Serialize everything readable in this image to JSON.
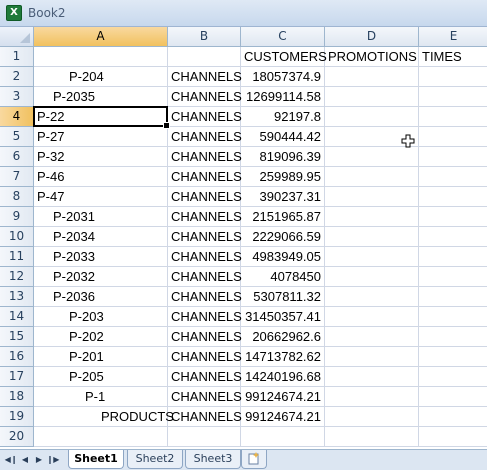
{
  "window": {
    "title": "Book2",
    "app_icon": "excel-icon"
  },
  "columns": [
    "A",
    "B",
    "C",
    "D",
    "E"
  ],
  "selected_cell": "A4",
  "rows": [
    {
      "n": "1",
      "a": "",
      "b": "",
      "c": "CUSTOMERS",
      "d": "PROMOTIONS",
      "e": "TIMES"
    },
    {
      "n": "2",
      "a": "P-204",
      "b": "CHANNELS",
      "c": "18057374.9",
      "d": "",
      "e": ""
    },
    {
      "n": "3",
      "a": "P-2035",
      "b": "CHANNELS",
      "c": "12699114.58",
      "d": "",
      "e": ""
    },
    {
      "n": "4",
      "a": "P-22",
      "b": "CHANNELS",
      "c": "92197.8",
      "d": "",
      "e": ""
    },
    {
      "n": "5",
      "a": "P-27",
      "b": "CHANNELS",
      "c": "590444.42",
      "d": "",
      "e": ""
    },
    {
      "n": "6",
      "a": "P-32",
      "b": "CHANNELS",
      "c": "819096.39",
      "d": "",
      "e": ""
    },
    {
      "n": "7",
      "a": "P-46",
      "b": "CHANNELS",
      "c": "259989.95",
      "d": "",
      "e": ""
    },
    {
      "n": "8",
      "a": "P-47",
      "b": "CHANNELS",
      "c": "390237.31",
      "d": "",
      "e": ""
    },
    {
      "n": "9",
      "a": "P-2031",
      "b": "CHANNELS",
      "c": "2151965.87",
      "d": "",
      "e": ""
    },
    {
      "n": "10",
      "a": "P-2034",
      "b": "CHANNELS",
      "c": "2229066.59",
      "d": "",
      "e": ""
    },
    {
      "n": "11",
      "a": "P-2033",
      "b": "CHANNELS",
      "c": "4983949.05",
      "d": "",
      "e": ""
    },
    {
      "n": "12",
      "a": "P-2032",
      "b": "CHANNELS",
      "c": "4078450",
      "d": "",
      "e": ""
    },
    {
      "n": "13",
      "a": "P-2036",
      "b": "CHANNELS",
      "c": "5307811.32",
      "d": "",
      "e": ""
    },
    {
      "n": "14",
      "a": "P-203",
      "b": "CHANNELS",
      "c": "31450357.41",
      "d": "",
      "e": ""
    },
    {
      "n": "15",
      "a": "P-202",
      "b": "CHANNELS",
      "c": "20662962.6",
      "d": "",
      "e": ""
    },
    {
      "n": "16",
      "a": "P-201",
      "b": "CHANNELS",
      "c": "14713782.62",
      "d": "",
      "e": ""
    },
    {
      "n": "17",
      "a": "P-205",
      "b": "CHANNELS",
      "c": "14240196.68",
      "d": "",
      "e": ""
    },
    {
      "n": "18",
      "a": "P-1",
      "b": "CHANNELS",
      "c": "99124674.21",
      "d": "",
      "e": ""
    },
    {
      "n": "19",
      "a": "PRODUCTS",
      "b": "CHANNELS",
      "c": "99124674.21",
      "d": "",
      "e": ""
    },
    {
      "n": "20",
      "a": "",
      "b": "",
      "c": "",
      "d": "",
      "e": ""
    }
  ],
  "a_indent": [
    0,
    4,
    2,
    0,
    0,
    0,
    0,
    0,
    2,
    2,
    2,
    2,
    2,
    4,
    4,
    4,
    4,
    6,
    8,
    0
  ],
  "sheet_tabs": [
    {
      "label": "Sheet1",
      "active": true
    },
    {
      "label": "Sheet2",
      "active": false
    },
    {
      "label": "Sheet3",
      "active": false
    }
  ],
  "nav_icons": [
    "first-sheet-icon",
    "prev-sheet-icon",
    "next-sheet-icon",
    "last-sheet-icon"
  ],
  "colors": {
    "header_active": "#f1c15f",
    "gridline": "#d0d7e5",
    "header_border": "#9eb6ce"
  }
}
